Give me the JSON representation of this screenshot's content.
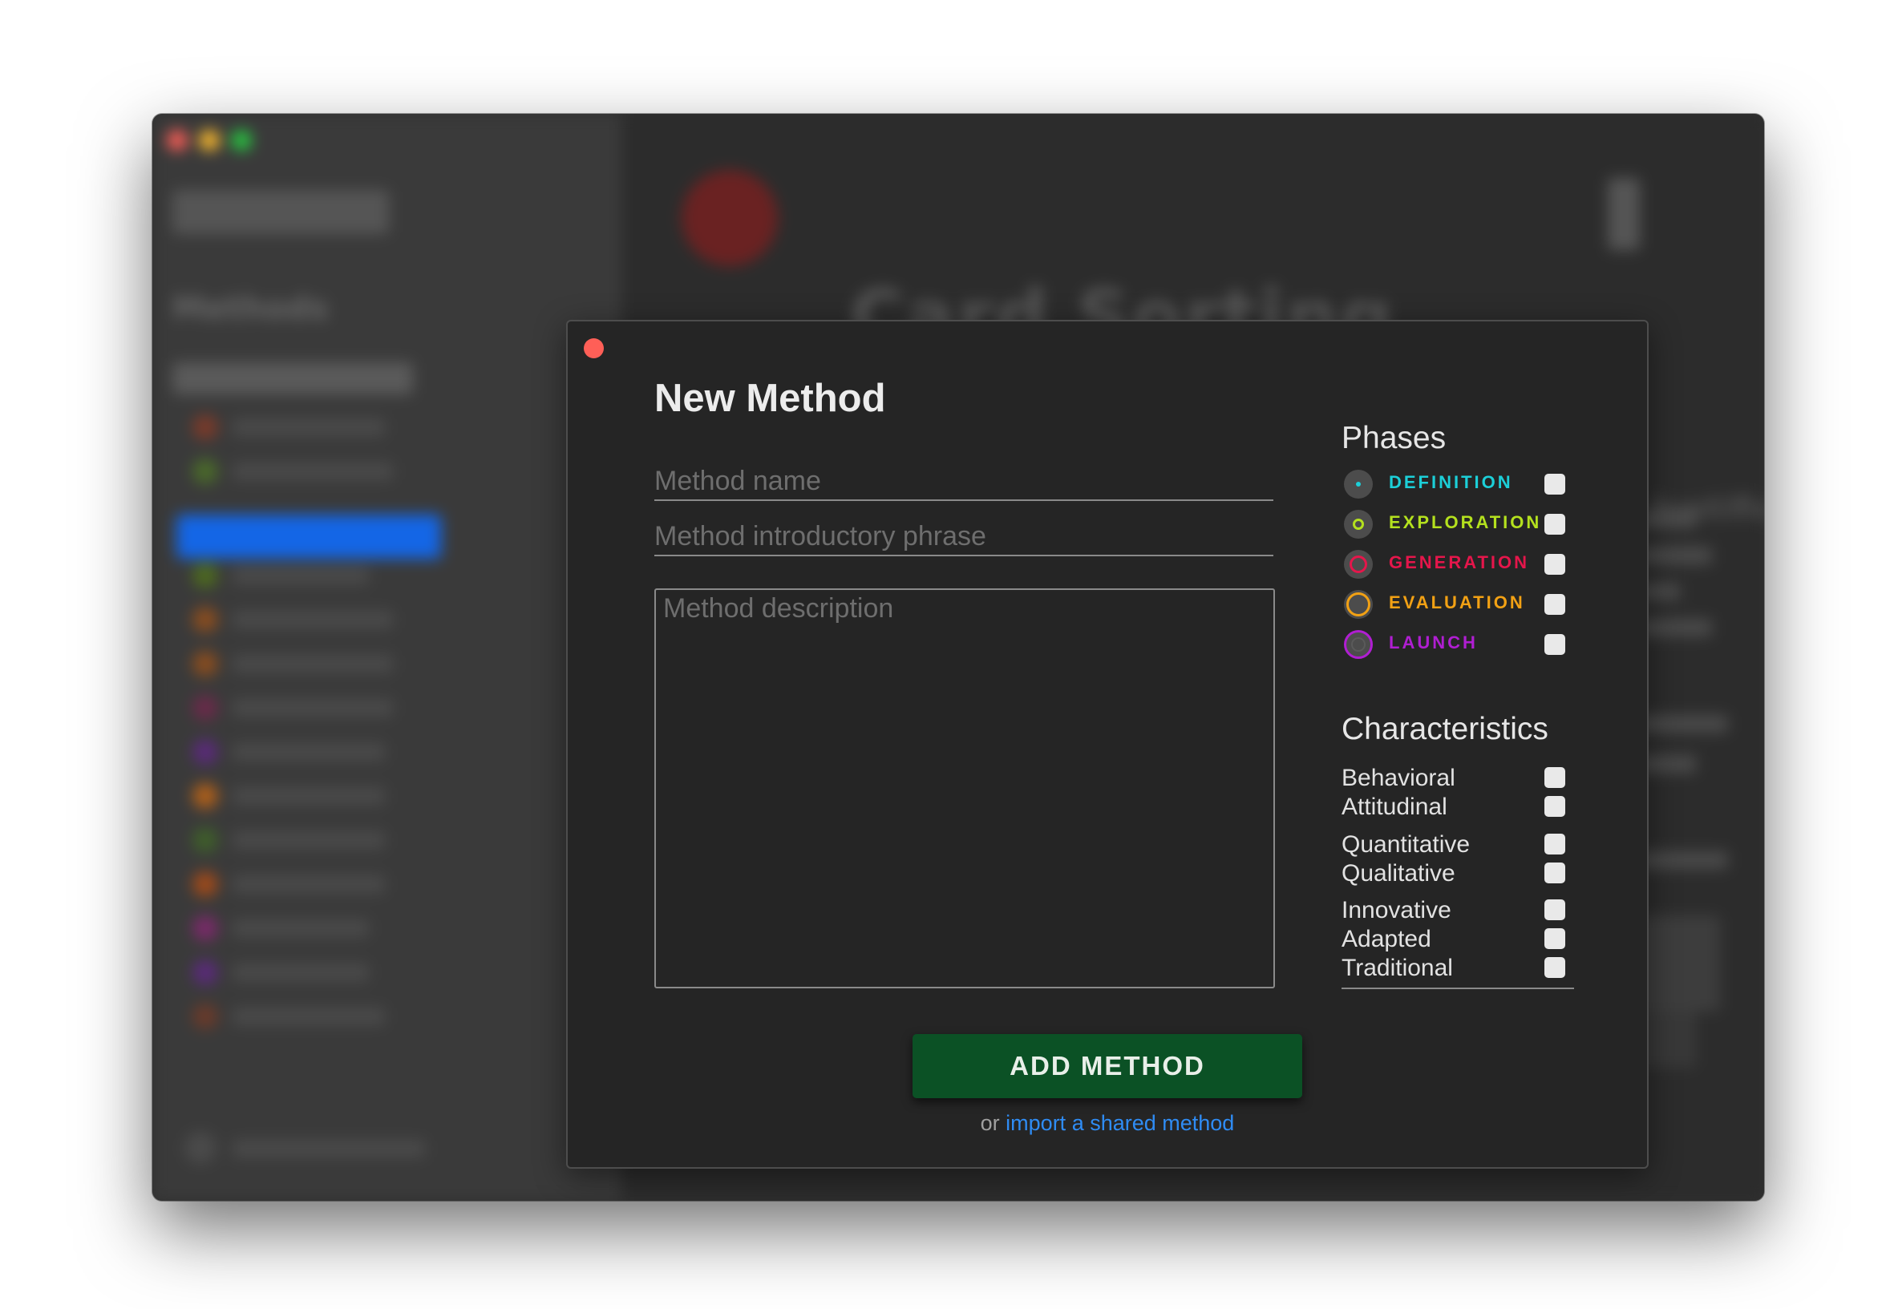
{
  "background_app": {
    "title": "Card Sorting",
    "sidebar_heading": "Methods",
    "detail_heading": "Justification"
  },
  "modal": {
    "title": "New Method",
    "method_name_placeholder": "Method name",
    "method_phrase_placeholder": "Method introductory phrase",
    "method_description_placeholder": "Method description",
    "phases_title": "Phases",
    "phases": [
      {
        "label": "DEFINITION",
        "color": "#1ccfd8",
        "icon": "definition-dot-icon"
      },
      {
        "label": "EXPLORATION",
        "color": "#b4e11e",
        "icon": "exploration-ring-icon"
      },
      {
        "label": "GENERATION",
        "color": "#e5164b",
        "icon": "generation-ring-icon"
      },
      {
        "label": "EVALUATION",
        "color": "#f2a114",
        "icon": "evaluation-ring-icon"
      },
      {
        "label": "LAUNCH",
        "color": "#b01ed2",
        "icon": "launch-ring-icon"
      }
    ],
    "characteristics_title": "Characteristics",
    "characteristics": [
      {
        "label": "Behavioral"
      },
      {
        "label": "Attitudinal"
      },
      {
        "label": "Quantitative"
      },
      {
        "label": "Qualitative"
      },
      {
        "label": "Innovative"
      },
      {
        "label": "Adapted"
      },
      {
        "label": "Traditional"
      }
    ],
    "add_button_label": "ADD METHOD",
    "import_prefix": "or ",
    "import_link_label": "import a shared method"
  },
  "colors": {
    "modal_background": "#252525",
    "close_button": "#ff5f57",
    "add_button": "#0b5125",
    "link": "#2f8cf4"
  }
}
